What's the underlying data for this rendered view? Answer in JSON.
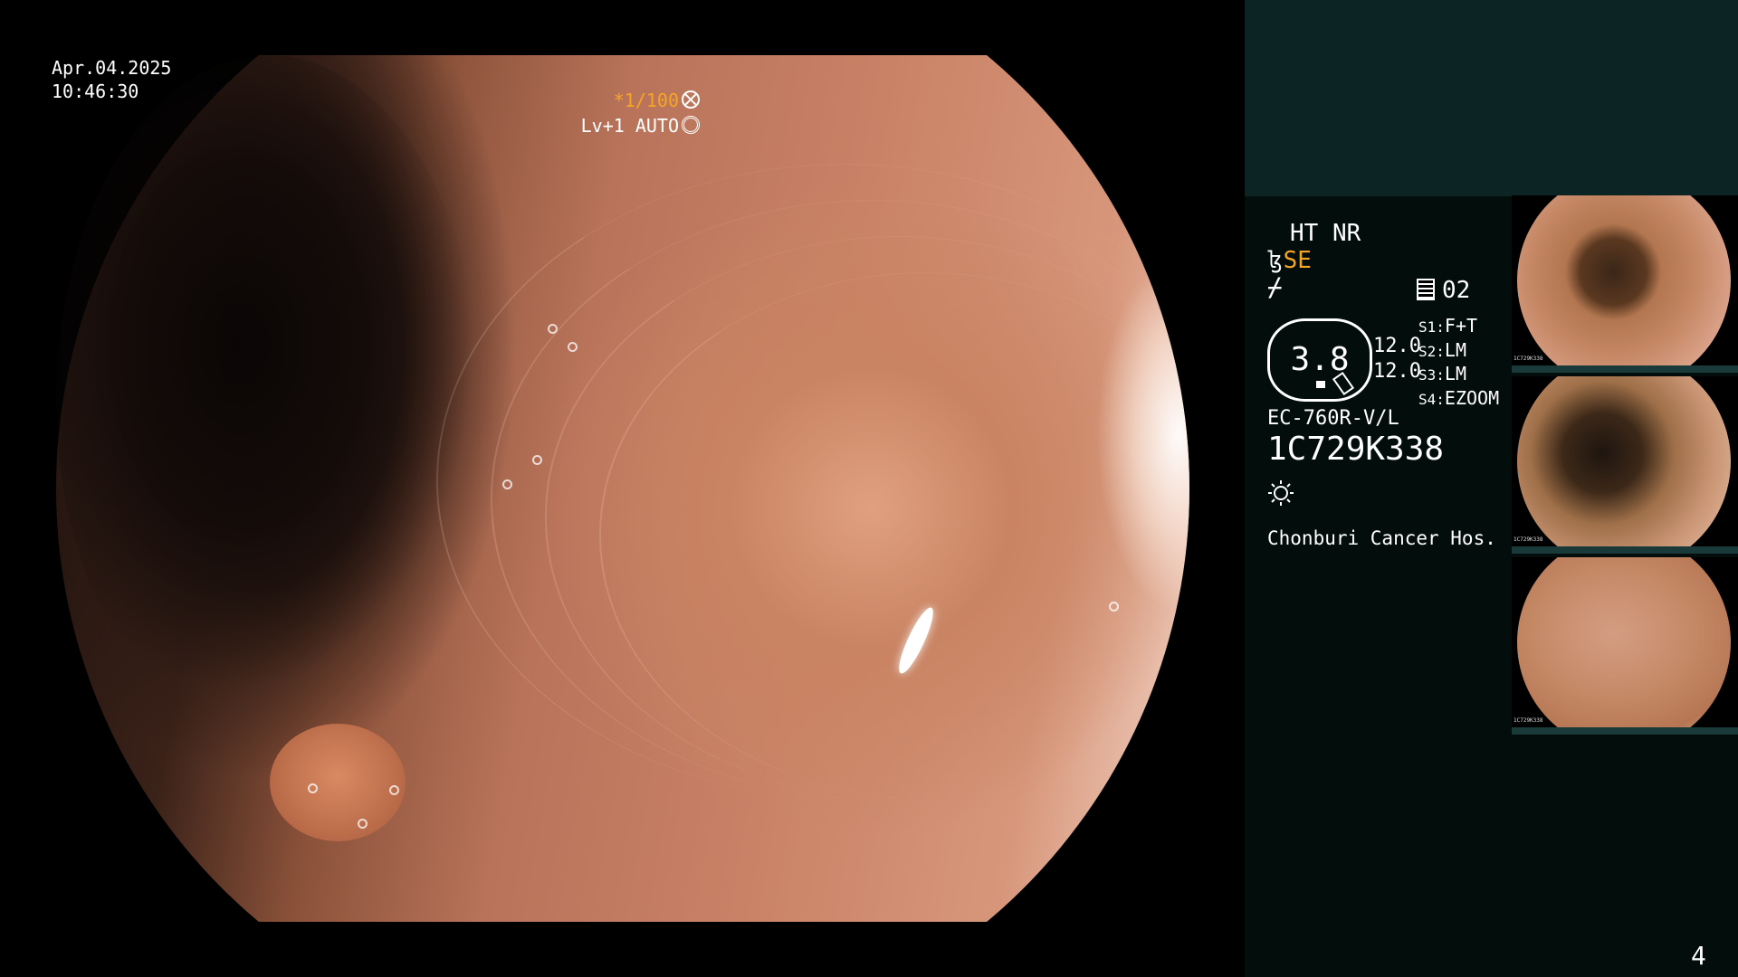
{
  "overlay": {
    "date": "Apr.04.2025",
    "time": "10:46:30",
    "shutter": "*1/100",
    "level": "Lv+1 AUTO"
  },
  "side_panel": {
    "mode": "HT NR",
    "structure_enhancement": "SE",
    "memory": "02",
    "zoom_value": "3.8",
    "value_1": "12.0",
    "value_2": "12.0",
    "switches": [
      {
        "key": "S1:",
        "value": "F+T"
      },
      {
        "key": "S2:",
        "value": "LM"
      },
      {
        "key": "S3:",
        "value": "LM"
      },
      {
        "key": "S4:",
        "value": "EZOOM"
      }
    ],
    "scope_model": "EC-760R-V/L",
    "serial": "1C729K338",
    "hospital": "Chonburi Cancer Hos.",
    "thumbnails": [
      {
        "caption": "1C729K338"
      },
      {
        "caption": "1C729K338"
      },
      {
        "caption": "1C729K338"
      }
    ]
  },
  "page_number": "4",
  "colors": {
    "accent_orange": "#f6a623",
    "panel_dark": "#020d0c",
    "panel_top": "#0c2424"
  }
}
